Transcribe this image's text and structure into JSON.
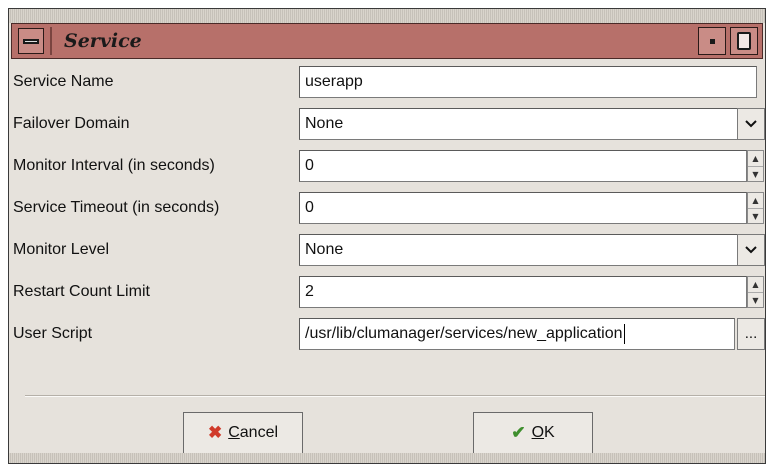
{
  "window": {
    "title": "Service"
  },
  "form": {
    "service_name": {
      "label": "Service Name",
      "value": "userapp"
    },
    "failover_domain": {
      "label": "Failover Domain",
      "value": "None"
    },
    "monitor_interval": {
      "label": "Monitor Interval (in seconds)",
      "value": "0"
    },
    "service_timeout": {
      "label": "Service Timeout (in seconds)",
      "value": "0"
    },
    "monitor_level": {
      "label": "Monitor Level",
      "value": "None"
    },
    "restart_count_limit": {
      "label": "Restart Count Limit",
      "value": "2"
    },
    "user_script": {
      "label": "User Script",
      "value": "/usr/lib/clumanager/services/new_application",
      "browse_label": "..."
    }
  },
  "buttons": {
    "cancel": {
      "underlined": "C",
      "rest": "ancel",
      "icon": "x-icon"
    },
    "ok": {
      "underlined": "O",
      "rest": "K",
      "icon": "checkmark-icon"
    }
  },
  "colors": {
    "titlebar": "#b7706a",
    "background": "#e6e2dc",
    "cancel_icon": "#d03a2a",
    "ok_icon": "#3f8f2e"
  }
}
